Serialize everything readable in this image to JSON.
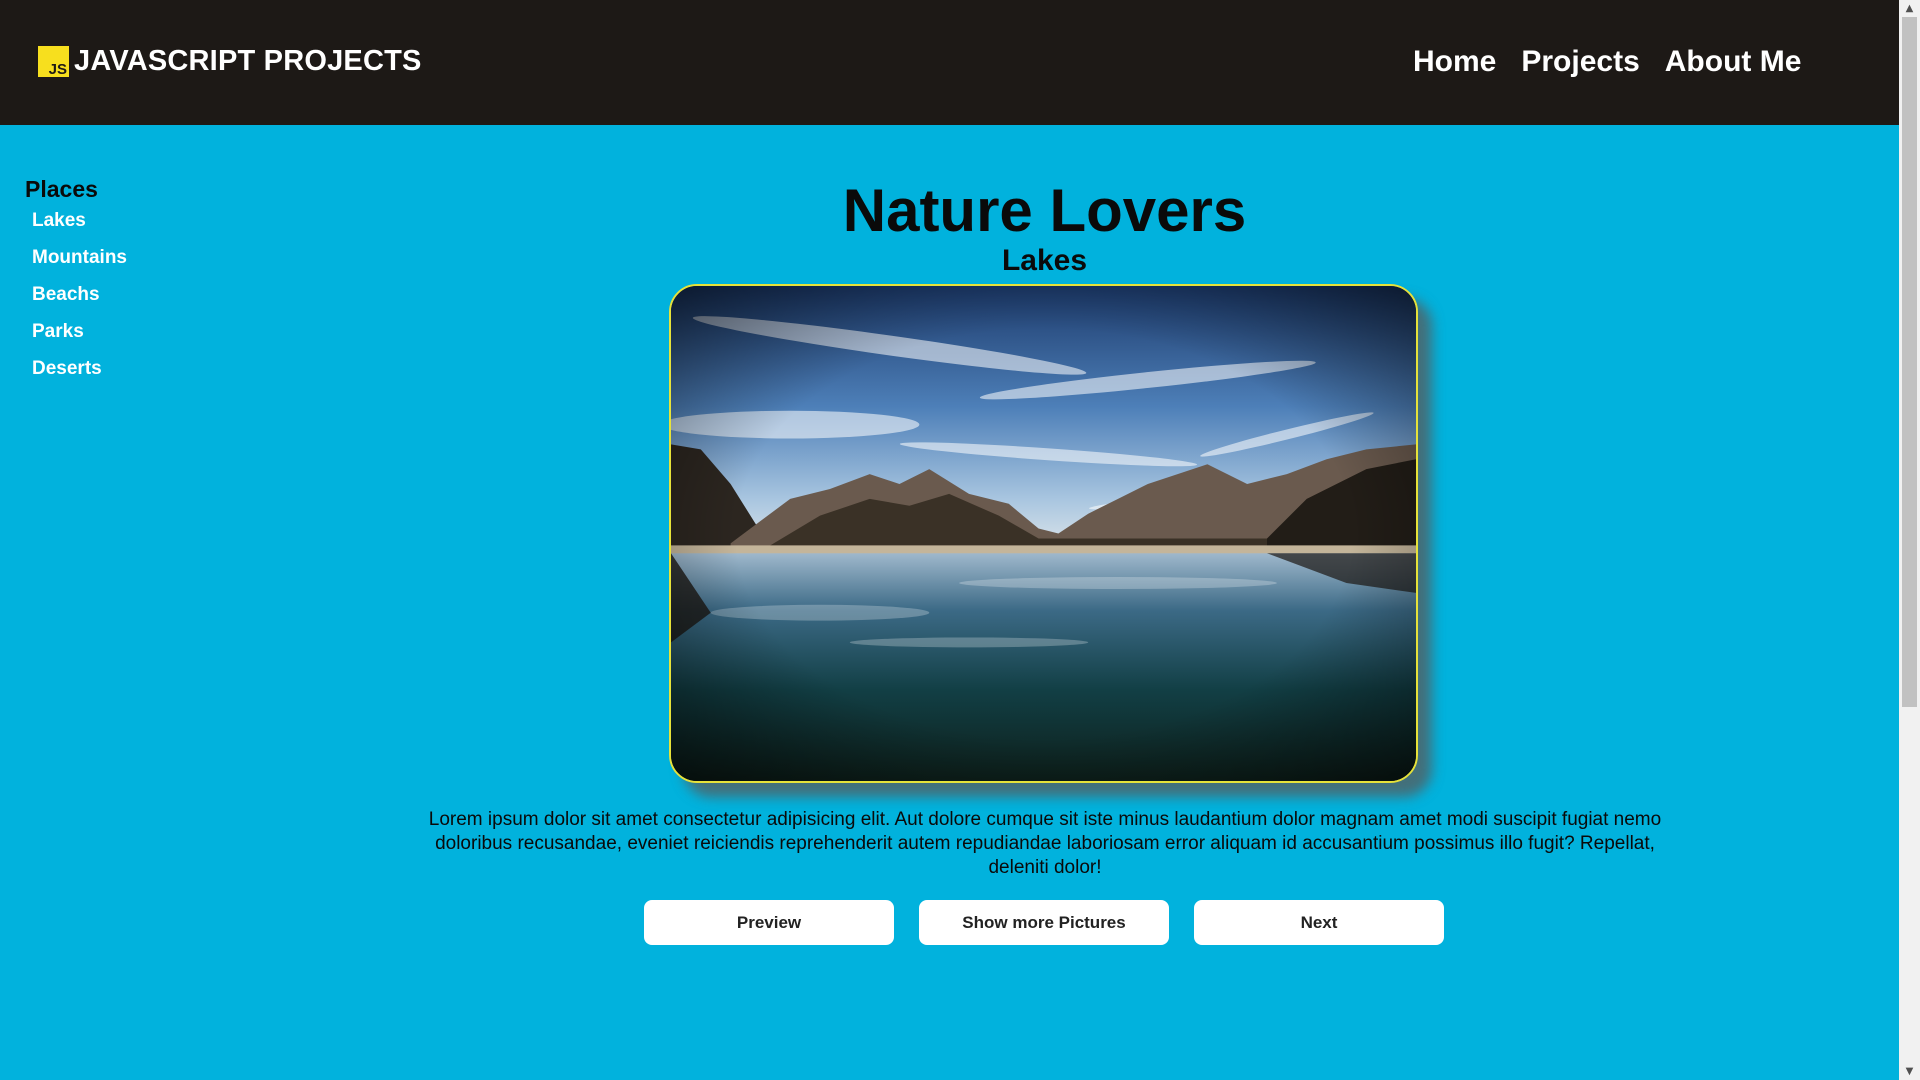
{
  "header": {
    "logo_text": "JS",
    "title": "JAVASCRIPT PROJECTS",
    "nav": [
      {
        "label": "Home"
      },
      {
        "label": "Projects"
      },
      {
        "label": "About Me"
      }
    ]
  },
  "sidebar": {
    "title": "Places",
    "items": [
      {
        "label": "Lakes"
      },
      {
        "label": "Mountains"
      },
      {
        "label": "Beachs"
      },
      {
        "label": "Parks"
      },
      {
        "label": "Deserts"
      }
    ]
  },
  "main": {
    "title": "Nature Lovers",
    "subtitle": "Lakes",
    "description": "Lorem ipsum dolor sit amet consectetur adipisicing elit. Aut dolore cumque sit iste minus laudantium dolor magnam amet modi suscipit fugiat nemo doloribus recusandae, eveniet reiciendis reprehenderit autem repudiandae laboriosam error aliquam id accusantium possimus illo fugit? Repellat, deleniti dolor!",
    "buttons": {
      "preview": "Preview",
      "more": "Show more Pictures",
      "next": "Next"
    }
  },
  "colors": {
    "background": "#01b2dd",
    "header": "#1d1916",
    "frame_border": "#e6e23a",
    "js_logo": "#f7df1e"
  }
}
